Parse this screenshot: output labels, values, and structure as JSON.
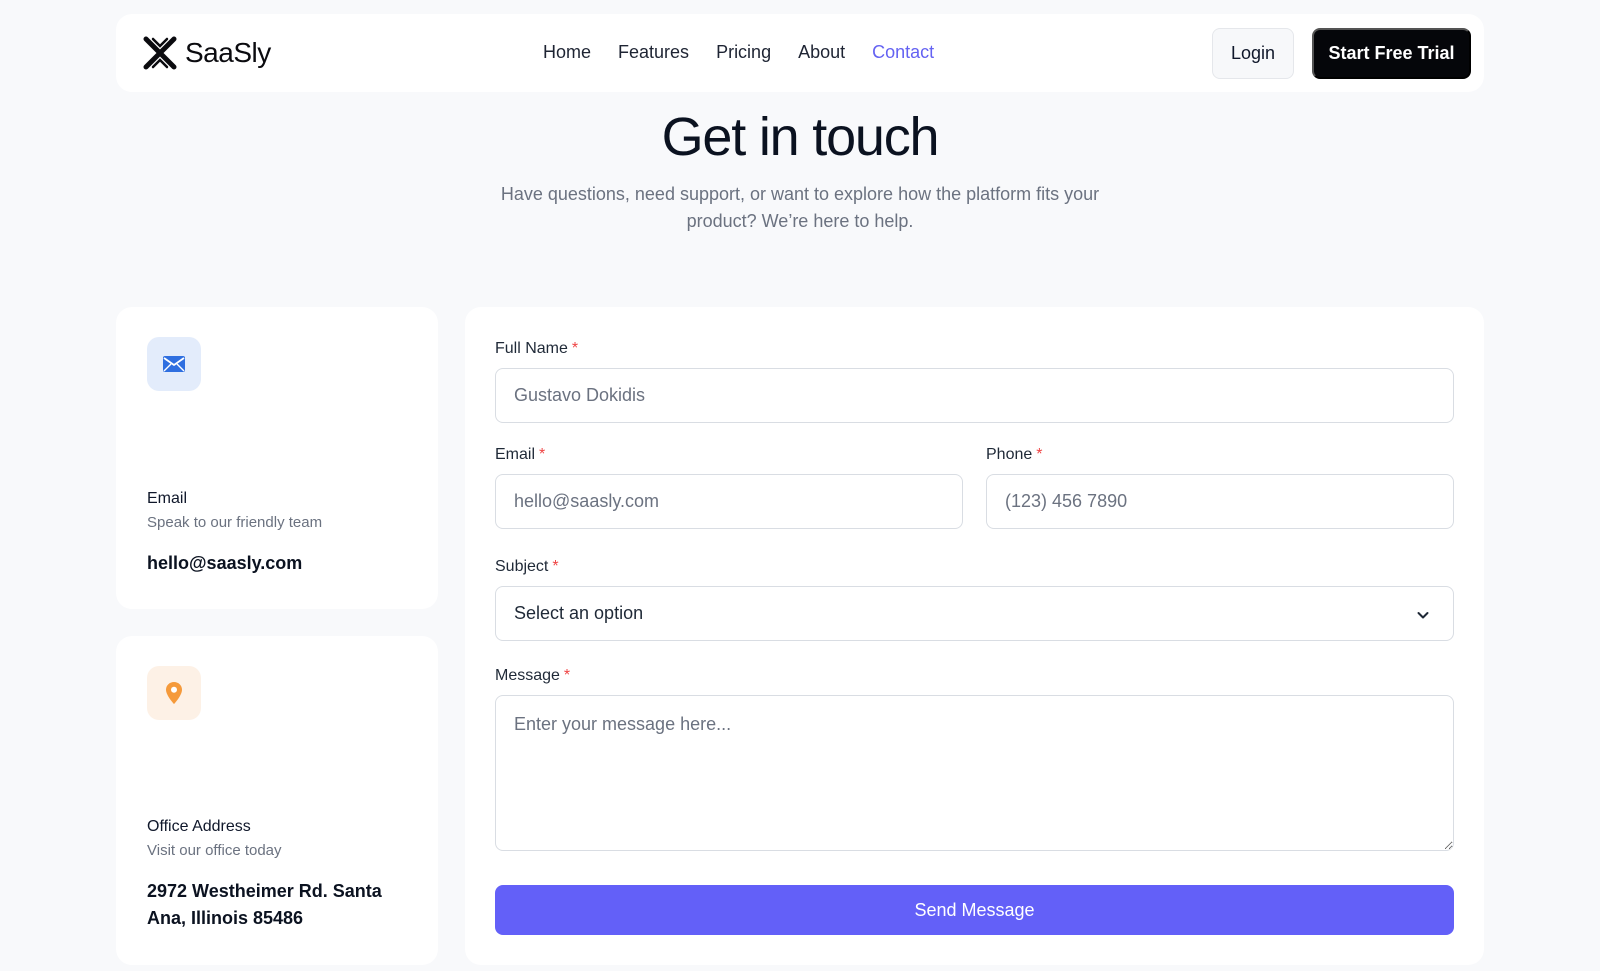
{
  "brand": {
    "name": "SaaSly",
    "logo_icon": "x-mark-logo-icon"
  },
  "nav": {
    "links": [
      {
        "label": "Home",
        "active": false
      },
      {
        "label": "Features",
        "active": false
      },
      {
        "label": "Pricing",
        "active": false
      },
      {
        "label": "About",
        "active": false
      },
      {
        "label": "Contact",
        "active": true
      }
    ],
    "login_label": "Login",
    "trial_label": "Start Free Trial"
  },
  "hero": {
    "title": "Get in touch",
    "subtitle": "Have questions, need support, or want to explore how the platform fits your product? We’re here to help."
  },
  "contact_cards": {
    "email": {
      "icon": "envelope-icon",
      "title": "Email",
      "subtitle": "Speak to our friendly team",
      "value": "hello@saasly.com"
    },
    "office": {
      "icon": "map-pin-icon",
      "title": "Office Address",
      "subtitle": "Visit our office today",
      "value": "2972 Westheimer Rd. Santa Ana, Illinois 85486"
    }
  },
  "form": {
    "required_marker": "*",
    "full_name": {
      "label": "Full Name",
      "value": "",
      "placeholder": "Gustavo Dokidis"
    },
    "email": {
      "label": "Email",
      "value": "",
      "placeholder": "hello@saasly.com"
    },
    "phone": {
      "label": "Phone",
      "value": "",
      "placeholder": "(123) 456 7890"
    },
    "subject": {
      "label": "Subject",
      "selected": "Select an option",
      "icon": "chevron-down-icon"
    },
    "message": {
      "label": "Message",
      "value": "",
      "placeholder": "Enter your message here..."
    },
    "submit_label": "Send Message"
  },
  "colors": {
    "accent": "#6360f8",
    "active_nav": "#6462f2",
    "required": "#ef4444",
    "dark_button": "#05060a",
    "page_background": "#f8f9fb",
    "email_tile": "#e3ecfb",
    "email_icon": "#2f6fe0",
    "office_tile": "#fdf1e6",
    "office_icon": "#f59a3b"
  }
}
